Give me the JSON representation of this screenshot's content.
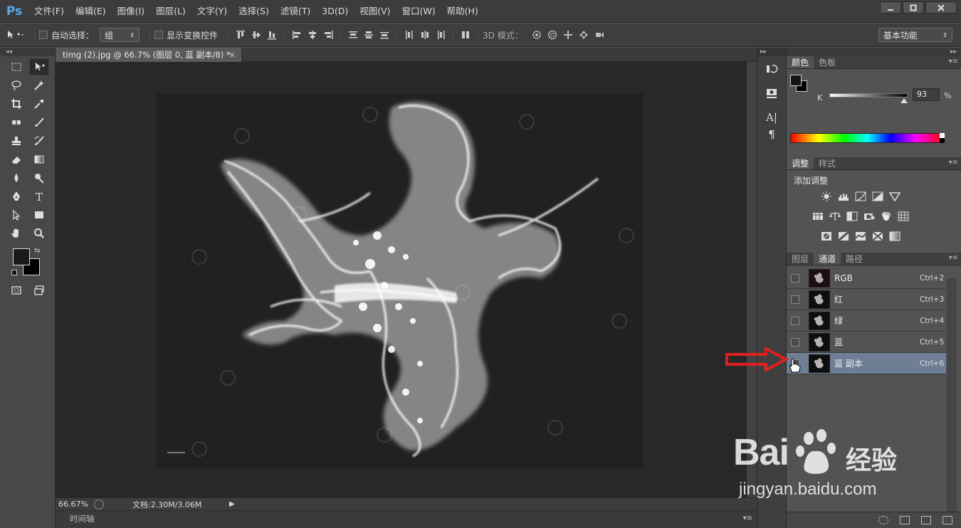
{
  "app": {
    "logo": "Ps",
    "menu": [
      "文件(F)",
      "编辑(E)",
      "图像(I)",
      "图层(L)",
      "文字(Y)",
      "选择(S)",
      "滤镜(T)",
      "3D(D)",
      "视图(V)",
      "窗口(W)",
      "帮助(H)"
    ],
    "window_controls": [
      "minimize-icon",
      "maximize-icon",
      "close-icon"
    ]
  },
  "options": {
    "auto_select_label": "自动选择：",
    "auto_select_value": "组",
    "show_transform_label": "显示变换控件",
    "mode_3d_label": "3D 模式：",
    "workspace_value": "基本功能"
  },
  "document": {
    "tab_title": "timg (2).jpg @ 66.7% (图层 0, 蓝 副本/8) *",
    "tab_close": "×",
    "zoom": "66.67%",
    "doc_info": "文档:2.30M/3.06M",
    "timeline_label": "时间轴"
  },
  "color_panel": {
    "tabs": [
      "颜色",
      "色板"
    ],
    "active_tab": 0,
    "channel_label": "K",
    "k_value": "93",
    "k_unit": "%",
    "k_fraction": 0.93,
    "foreground": "#151515",
    "background": "#000000"
  },
  "adjust_panel": {
    "tabs": [
      "调整",
      "样式"
    ],
    "active_tab": 0,
    "title": "添加调整"
  },
  "channels_panel": {
    "tabs": [
      "图层",
      "通道",
      "路径"
    ],
    "active_tab": 1,
    "channels": [
      {
        "name": "RGB",
        "shortcut": "Ctrl+2",
        "selected": false
      },
      {
        "name": "红",
        "shortcut": "Ctrl+3",
        "selected": false
      },
      {
        "name": "绿",
        "shortcut": "Ctrl+4",
        "selected": false
      },
      {
        "name": "蓝",
        "shortcut": "Ctrl+5",
        "selected": false
      },
      {
        "name": "蓝 副本",
        "shortcut": "Ctrl+6",
        "selected": true
      }
    ]
  },
  "watermark": {
    "brand": "Bai",
    "brand_cn": "经验",
    "url": "jingyan.baidu.com"
  },
  "colors": {
    "accent_selection": "#6e7f95",
    "arrow": "#e02020",
    "ps_blue": "#5aa8e8"
  }
}
